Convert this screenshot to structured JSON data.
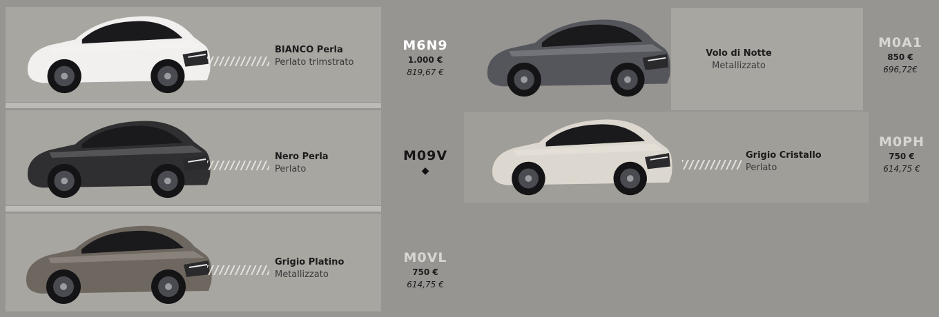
{
  "colors": {
    "background": "#979592",
    "panel": "#a8a6a1",
    "strip": "#bdbbb7",
    "code_highlight": "#ffffff",
    "code_muted": "#d8d6d2"
  },
  "options": [
    {
      "name": "BIANCO Perla",
      "finish": "Perlato trimstrato",
      "code": "M6N9",
      "price": "1.000 €",
      "price_net": "819,67 €",
      "car_color": "white"
    },
    {
      "name": "Volo di Notte",
      "finish": "Metallizzato",
      "code": "M0A1",
      "price": "850 €",
      "price_net": "696,72€",
      "car_color": "dark-grey"
    },
    {
      "name": "Nero Perla",
      "finish": "Perlato",
      "code": "M09V",
      "marker": "◆",
      "car_color": "black"
    },
    {
      "name": "Grigio Cristallo",
      "finish": "Perlato",
      "code": "M0PH",
      "price": "750 €",
      "price_net": "614,75 €",
      "car_color": "cream"
    },
    {
      "name": "Grigio Platino",
      "finish": "Metallizzato",
      "code": "M0VL",
      "price": "750 €",
      "price_net": "614,75 €",
      "car_color": "grey-bronze"
    }
  ]
}
